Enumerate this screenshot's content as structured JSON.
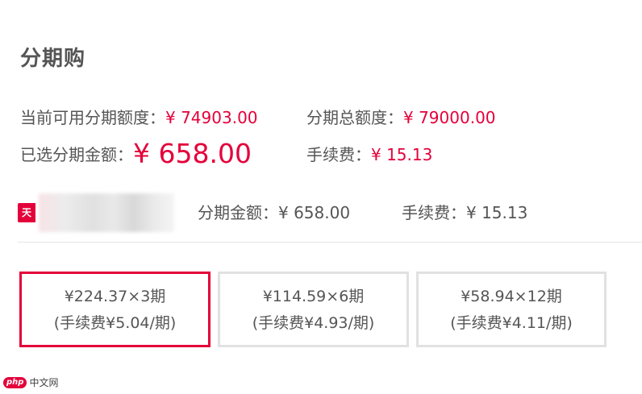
{
  "header": {
    "title": "分期购"
  },
  "summary": {
    "available_label": "当前可用分期额度：",
    "available_value": "¥ 74903.00",
    "total_label": "分期总额度：",
    "total_value": "¥ 79000.00",
    "selected_label": "已选分期金额：",
    "selected_value": "¥ 658.00",
    "fee_label": "手续费：",
    "fee_value": "¥ 15.13"
  },
  "card": {
    "tag": "天",
    "amount_text": "分期金额：¥ 658.00",
    "fee_text": "手续费：¥ 15.13"
  },
  "plans": [
    {
      "line1": "¥224.37×3期",
      "line2": "(手续费¥5.04/期)",
      "selected": true
    },
    {
      "line1": "¥114.59×6期",
      "line2": "(手续费¥4.93/期)",
      "selected": false
    },
    {
      "line1": "¥58.94×12期",
      "line2": "(手续费¥4.11/期)",
      "selected": false
    }
  ],
  "watermark": {
    "logo": "php",
    "text": "中文网"
  },
  "colors": {
    "accent": "#e4003a",
    "text": "#555555",
    "border": "#e1e1e1"
  }
}
